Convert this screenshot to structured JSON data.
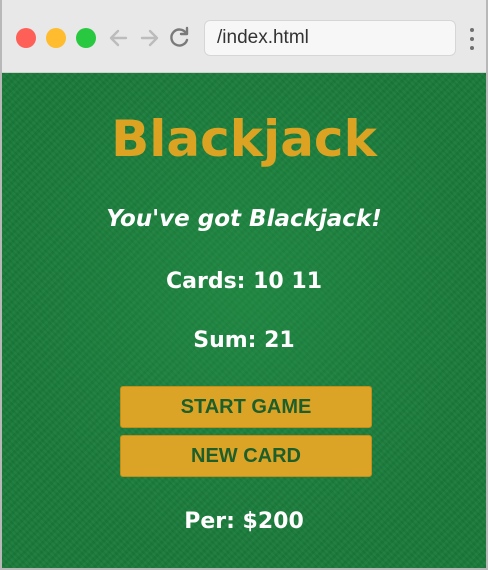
{
  "browser": {
    "address": "/index.html",
    "icons": {
      "close": "close-window-icon",
      "minimize": "minimize-window-icon",
      "maximize": "maximize-window-icon",
      "back": "back-arrow-icon",
      "forward": "forward-arrow-icon",
      "reload": "reload-icon",
      "menu": "kebab-menu-icon"
    }
  },
  "game": {
    "title": "Blackjack",
    "message": "You've got Blackjack!",
    "cards": "Cards: 10 11",
    "sum": "Sum: 21",
    "start_button": "START GAME",
    "new_card_button": "NEW CARD",
    "player": "Per: $200"
  },
  "colors": {
    "table_green": "#1a7a3a",
    "gold": "#dca323",
    "button_text": "#1e5e2a"
  }
}
